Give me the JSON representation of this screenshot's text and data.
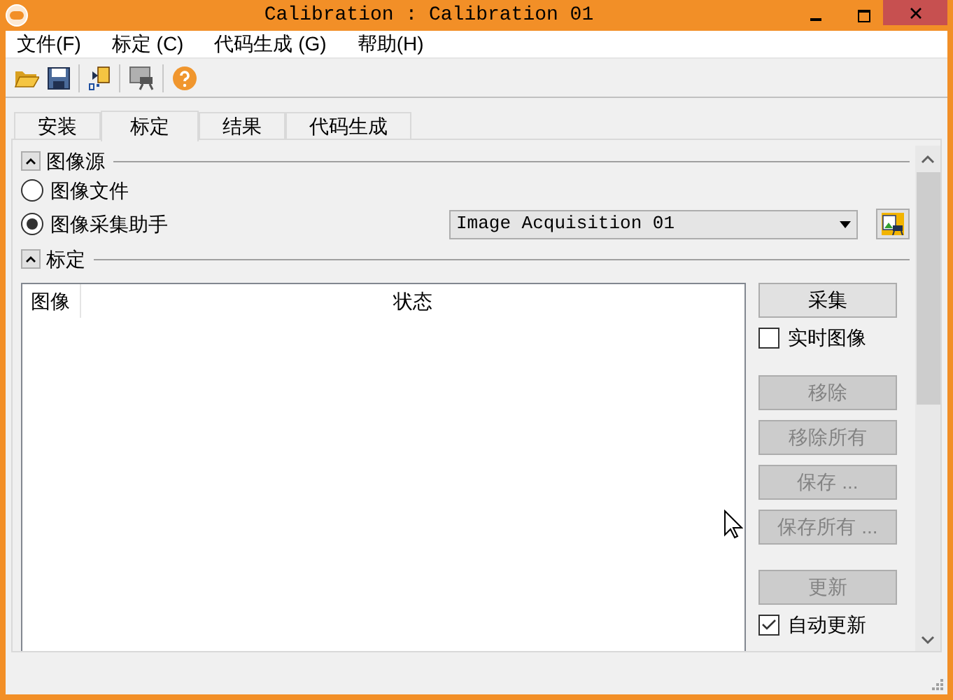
{
  "window": {
    "title": "Calibration : Calibration 01"
  },
  "menu": [
    "文件(F)",
    "标定 (C)",
    "代码生成 (G)",
    "帮助(H)"
  ],
  "tabs": [
    {
      "label": "安装",
      "selected": false
    },
    {
      "label": "标定",
      "selected": true
    },
    {
      "label": "结果",
      "selected": false
    },
    {
      "label": "代码生成",
      "selected": false
    }
  ],
  "image_source": {
    "title": "图像源",
    "expanded": true,
    "options": [
      {
        "label": "图像文件",
        "selected": false
      },
      {
        "label": "图像采集助手",
        "selected": true
      }
    ],
    "acquisition": {
      "value": "Image Acquisition 01"
    }
  },
  "calibration": {
    "title": "标定",
    "expanded": true,
    "table": {
      "columns": [
        "图像",
        "状态"
      ]
    },
    "controls": [
      {
        "kind": "button",
        "label": "采集",
        "disabled": false
      },
      {
        "kind": "checkbox",
        "label": "实时图像",
        "checked": false
      },
      {
        "kind": "button",
        "label": "移除",
        "disabled": true
      },
      {
        "kind": "button",
        "label": "移除所有",
        "disabled": true
      },
      {
        "kind": "button",
        "label": "保存 ...",
        "disabled": true
      },
      {
        "kind": "button",
        "label": "保存所有 ...",
        "disabled": true
      },
      {
        "kind": "button",
        "label": "更新",
        "disabled": true
      },
      {
        "kind": "checkbox",
        "label": "自动更新",
        "checked": true
      }
    ]
  }
}
